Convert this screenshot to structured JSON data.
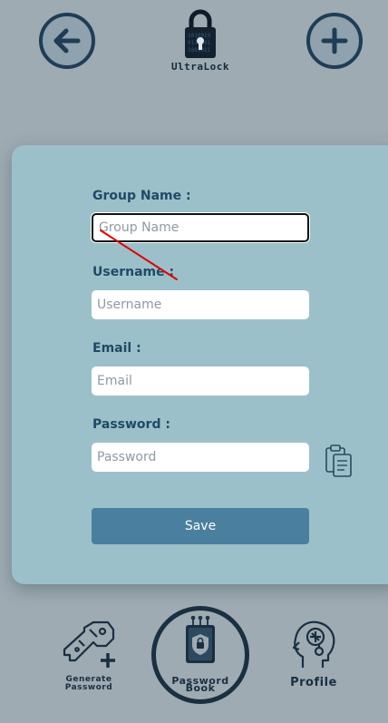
{
  "app": {
    "logo_text": "UltraLock"
  },
  "header": {
    "back_icon": "arrow-left-icon",
    "add_icon": "plus-icon"
  },
  "form": {
    "group_label": "Group Name :",
    "group_placeholder": "Group Name",
    "username_label": "Username :",
    "username_placeholder": "Username",
    "email_label": "Email :",
    "email_placeholder": "Email",
    "password_label": "Password :",
    "password_placeholder": "Password",
    "save_label": "Save"
  },
  "nav": {
    "generate_line1": "Generate",
    "generate_line2": "Password",
    "book_line1": "Password",
    "book_line2": "Book",
    "profile": "Profile"
  },
  "colors": {
    "background": "#9eabb3",
    "card": "#9cc0c9",
    "accent": "#4a7f9f",
    "dark": "#1f3d55",
    "annotation": "#e00000"
  }
}
